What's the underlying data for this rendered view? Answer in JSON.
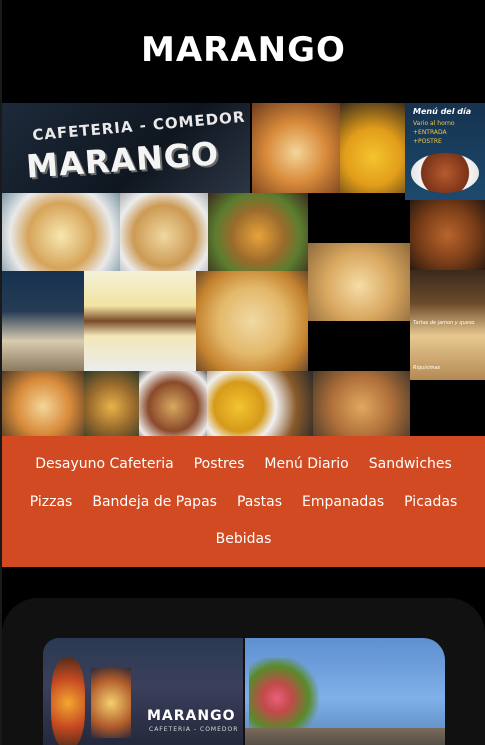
{
  "header": {
    "title": "MARANGO"
  },
  "collage": {
    "logo": {
      "top_text": "CAFETERIA - COMEDOR",
      "main_text": "MARANGO"
    },
    "menu_del_dia": {
      "title": "Menú del día",
      "lines": [
        "Vario al horno",
        "+ENTRADA",
        "+POSTRE"
      ]
    },
    "caption_tartas": "Tartas de jamon y queso",
    "caption_riquisimas": "Riquisimas"
  },
  "nav": {
    "rows": [
      [
        "Desayuno Cafeteria",
        "Postres",
        "Menú Diario",
        "Sandwiches"
      ],
      [
        "Pizzas",
        "Bandeja de Papas",
        "Pastas",
        "Empanadas",
        "Picadas"
      ],
      [
        "Bebidas"
      ]
    ]
  },
  "gallery": {
    "sign_brand": "MARANGO",
    "sign_sub": "CAFETERIA - COMEDOR"
  },
  "colors": {
    "header_bg": "#000000",
    "nav_bg": "#d14a22",
    "nav_text": "#ffffff",
    "page_bg": "#000000"
  }
}
